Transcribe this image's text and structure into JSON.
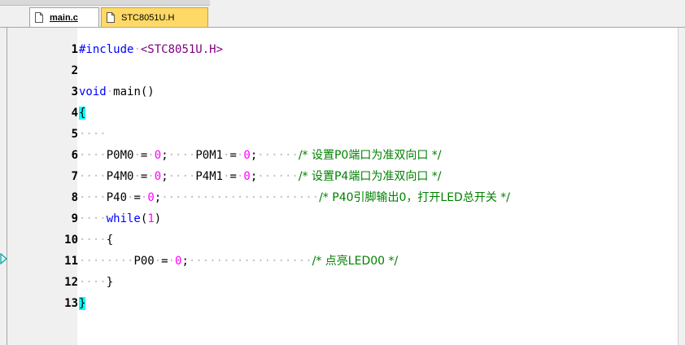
{
  "tabs": [
    {
      "label": "main.c",
      "active": true
    },
    {
      "label": "STC8051U.H",
      "active": false
    }
  ],
  "line_numbers": [
    "1",
    "2",
    "3",
    "4",
    "5",
    "6",
    "7",
    "8",
    "9",
    "10",
    "11",
    "12",
    "13"
  ],
  "code": {
    "l1_kw": "#include",
    "l1_str": "<STC8051U.H>",
    "l3_kw": "void",
    "l3_rest": "main()",
    "l4_brace": "{",
    "l6_a": "P0M0",
    "l6_b": "P0M1",
    "l6_comment": "/* 设置P0端口为准双向口 */",
    "l7_a": "P4M0",
    "l7_b": "P4M1",
    "l7_comment": "/* 设置P4端口为准双向口 */",
    "l8_a": "P40",
    "l8_comment": "/* P40引脚输出0，打开LED总开关 */",
    "l9_kw": "while",
    "l9_num": "1",
    "l10_brace": "{",
    "l11_a": "P00",
    "l11_comment": "/* 点亮LED00 */",
    "l12_brace": "}",
    "l13_brace": "}",
    "zero": "0",
    "eq": "=",
    "semi": ";"
  },
  "colors": {
    "keyword": "#0000ff",
    "string": "#800080",
    "number": "#ff00ff",
    "comment": "#008000",
    "brace_highlight": "#00ffff",
    "tab_inactive": "#ffd966"
  }
}
